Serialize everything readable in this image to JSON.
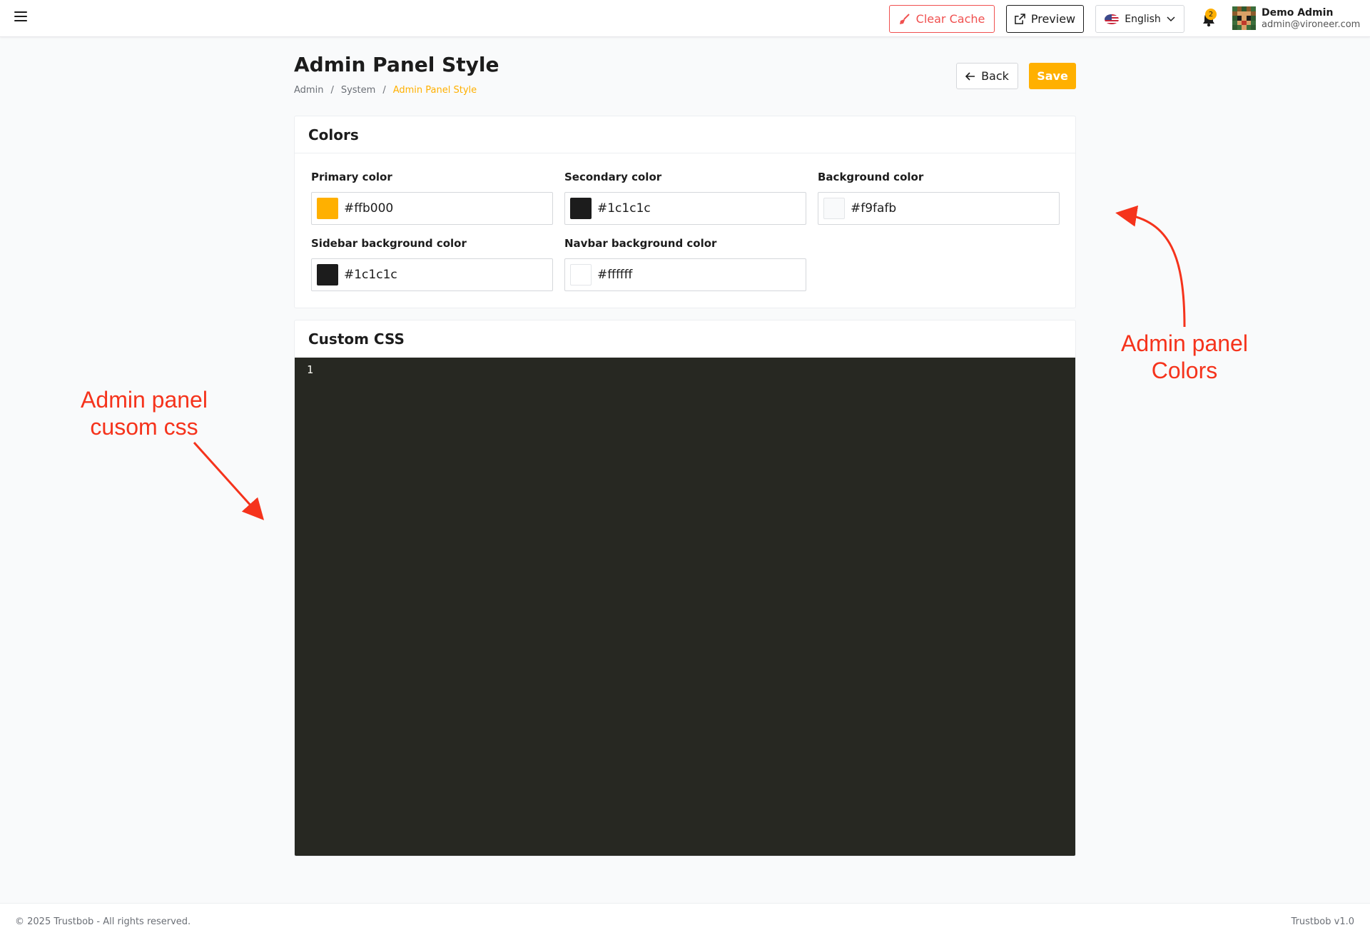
{
  "navbar": {
    "menu_icon": "hamburger-icon",
    "clear_cache_label": "Clear Cache",
    "clear_cache_icon": "broom-icon",
    "preview_label": "Preview",
    "preview_icon": "external-link-icon",
    "language_label": "English",
    "language_icon": "us-flag-icon",
    "notification_count": "2",
    "user_name": "Demo Admin",
    "user_email": "admin@vironeer.com"
  },
  "page": {
    "title": "Admin Panel Style",
    "breadcrumb": [
      "Admin",
      "System",
      "Admin Panel Style"
    ],
    "back_label": "Back",
    "save_label": "Save"
  },
  "colors_card": {
    "title": "Colors",
    "fields": [
      {
        "label": "Primary color",
        "value": "#ffb000",
        "swatch": "#ffb000"
      },
      {
        "label": "Secondary color",
        "value": "#1c1c1c",
        "swatch": "#1c1c1c"
      },
      {
        "label": "Background color",
        "value": "#f9fafb",
        "swatch": "#f9fafb"
      },
      {
        "label": "Sidebar background color",
        "value": "#1c1c1c",
        "swatch": "#1c1c1c"
      },
      {
        "label": "Navbar background color",
        "value": "#ffffff",
        "swatch": "#ffffff"
      }
    ]
  },
  "css_card": {
    "title": "Custom CSS",
    "line_number": "1"
  },
  "annotations": {
    "colors": [
      "Admin panel",
      "Colors"
    ],
    "css": [
      "Admin panel",
      "cusom css"
    ]
  },
  "footer": {
    "copyright": "© 2025 Trustbob - All rights reserved.",
    "version": "Trustbob v1.0"
  },
  "theme": {
    "accent": "#ffb000",
    "danger": "#f0504f",
    "editor_bg": "#272822",
    "annotation": "#f5331c"
  }
}
